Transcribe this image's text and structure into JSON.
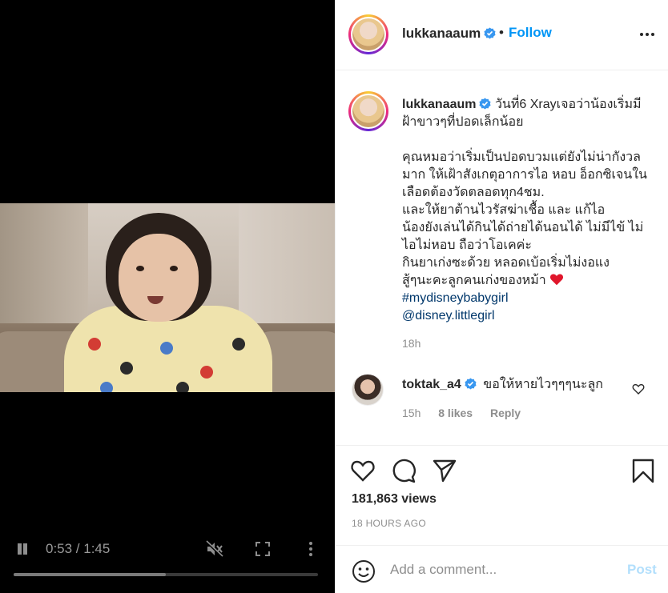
{
  "colors": {
    "accent": "#0095f6",
    "link": "#00376b",
    "muted": "#8e8e8e",
    "post_disabled": "#b2dffc",
    "heart": "#ed4956"
  },
  "video": {
    "current_time": "0:53",
    "duration": "1:45",
    "time_display": "0:53 / 1:45",
    "progress_fraction": 0.5
  },
  "header": {
    "username": "lukkanaaum",
    "verified": true,
    "dot": "•",
    "follow_label": "Follow",
    "more_icon": "more-horizontal-icon"
  },
  "caption": {
    "username": "lukkanaaum",
    "first_line": "วันที่6 Xrayเจอว่าน้องเริ่มมีฝ้าขาวๆที่ปอดเล็กน้อย",
    "body_lines": [
      "คุณหมอว่าเริ่มเป็นปอดบวมแต่ยังไม่น่ากังวลมาก ให้เฝ้าสังเกตุอาการไอ หอบ อ็อกซิเจนในเลือดต้องวัดตลอดทุก4ชม.",
      "และให้ยาต้านไวรัสฆ่าเชื้อ และ แก้ไอ",
      "น้องยังเล่นได้กินได้ถ่ายได้นอนได้ ไม่มีไข้ ไม่ไอไม่หอบ ถือว่าโอเคค่ะ",
      "กินยาเก่งซะด้วย หลอดเบ้อเริ่มไม่งอแง",
      "สู้ๆนะคะลูกคนเก่งของหม้า"
    ],
    "heart_emoji": "red-heart-emoji",
    "hashtag": "#mydisneybabygirl",
    "mention": "@disney.littlegirl",
    "time": "18h"
  },
  "reply": {
    "username": "toktak_a4",
    "verified": true,
    "text": "ขอให้หายไวๆๆๆนะลูก",
    "time": "15h",
    "likes": "8 likes",
    "reply_label": "Reply"
  },
  "actions": {
    "views": "181,863 views",
    "post_age": "18 HOURS AGO"
  },
  "add_comment": {
    "placeholder": "Add a comment...",
    "post_label": "Post"
  }
}
